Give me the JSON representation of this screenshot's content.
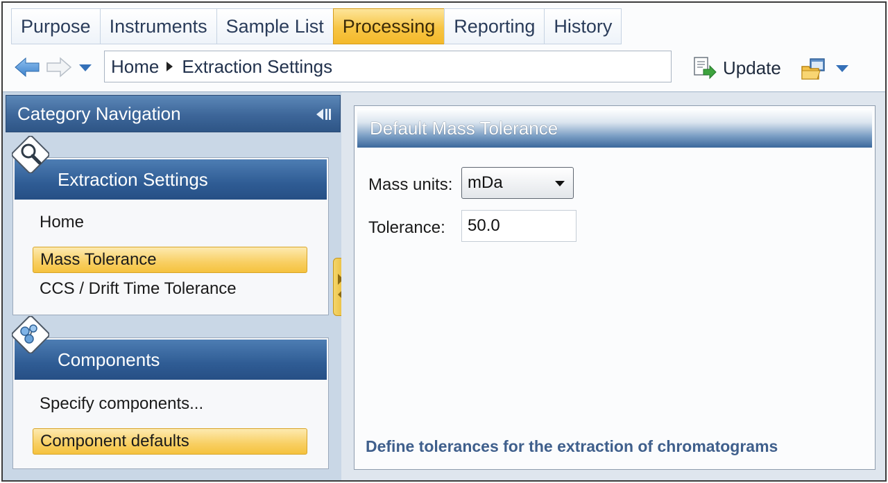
{
  "tabs": [
    {
      "label": "Purpose",
      "active": false
    },
    {
      "label": "Instruments",
      "active": false
    },
    {
      "label": "Sample List",
      "active": false
    },
    {
      "label": "Processing",
      "active": true
    },
    {
      "label": "Reporting",
      "active": false
    },
    {
      "label": "History",
      "active": false
    }
  ],
  "toolbar": {
    "back_icon": "arrow-left-icon",
    "forward_icon": "arrow-right-icon",
    "history_dropdown_icon": "chevron-down-icon",
    "breadcrumb": {
      "home": "Home",
      "current": "Extraction Settings"
    },
    "update_label": "Update",
    "update_icon": "document-arrow-icon",
    "window_icon": "folder-window-icon"
  },
  "sidebar": {
    "title": "Category Navigation",
    "collapse_icon": "collapse-left-icon",
    "groups": [
      {
        "title": "Extraction Settings",
        "icon": "magnifier-icon",
        "items": [
          {
            "label": "Home",
            "selected": false
          },
          {
            "label": "Mass Tolerance",
            "selected": true
          },
          {
            "label": "CCS / Drift Time Tolerance",
            "selected": false
          }
        ]
      },
      {
        "title": "Components",
        "icon": "molecule-icon",
        "items": [
          {
            "label": "Specify components...",
            "selected": false
          },
          {
            "label": "Component defaults",
            "selected": true
          }
        ]
      }
    ]
  },
  "main": {
    "title": "Default Mass Tolerance",
    "mass_units_label": "Mass units:",
    "mass_units_value": "mDa",
    "tolerance_label": "Tolerance:",
    "tolerance_value": "50.0",
    "description": "Define tolerances for the extraction of chromatograms"
  },
  "colors": {
    "accent": "#f7c544",
    "header_blue": "#2f5c94",
    "link_blue": "#3f5f8c"
  }
}
